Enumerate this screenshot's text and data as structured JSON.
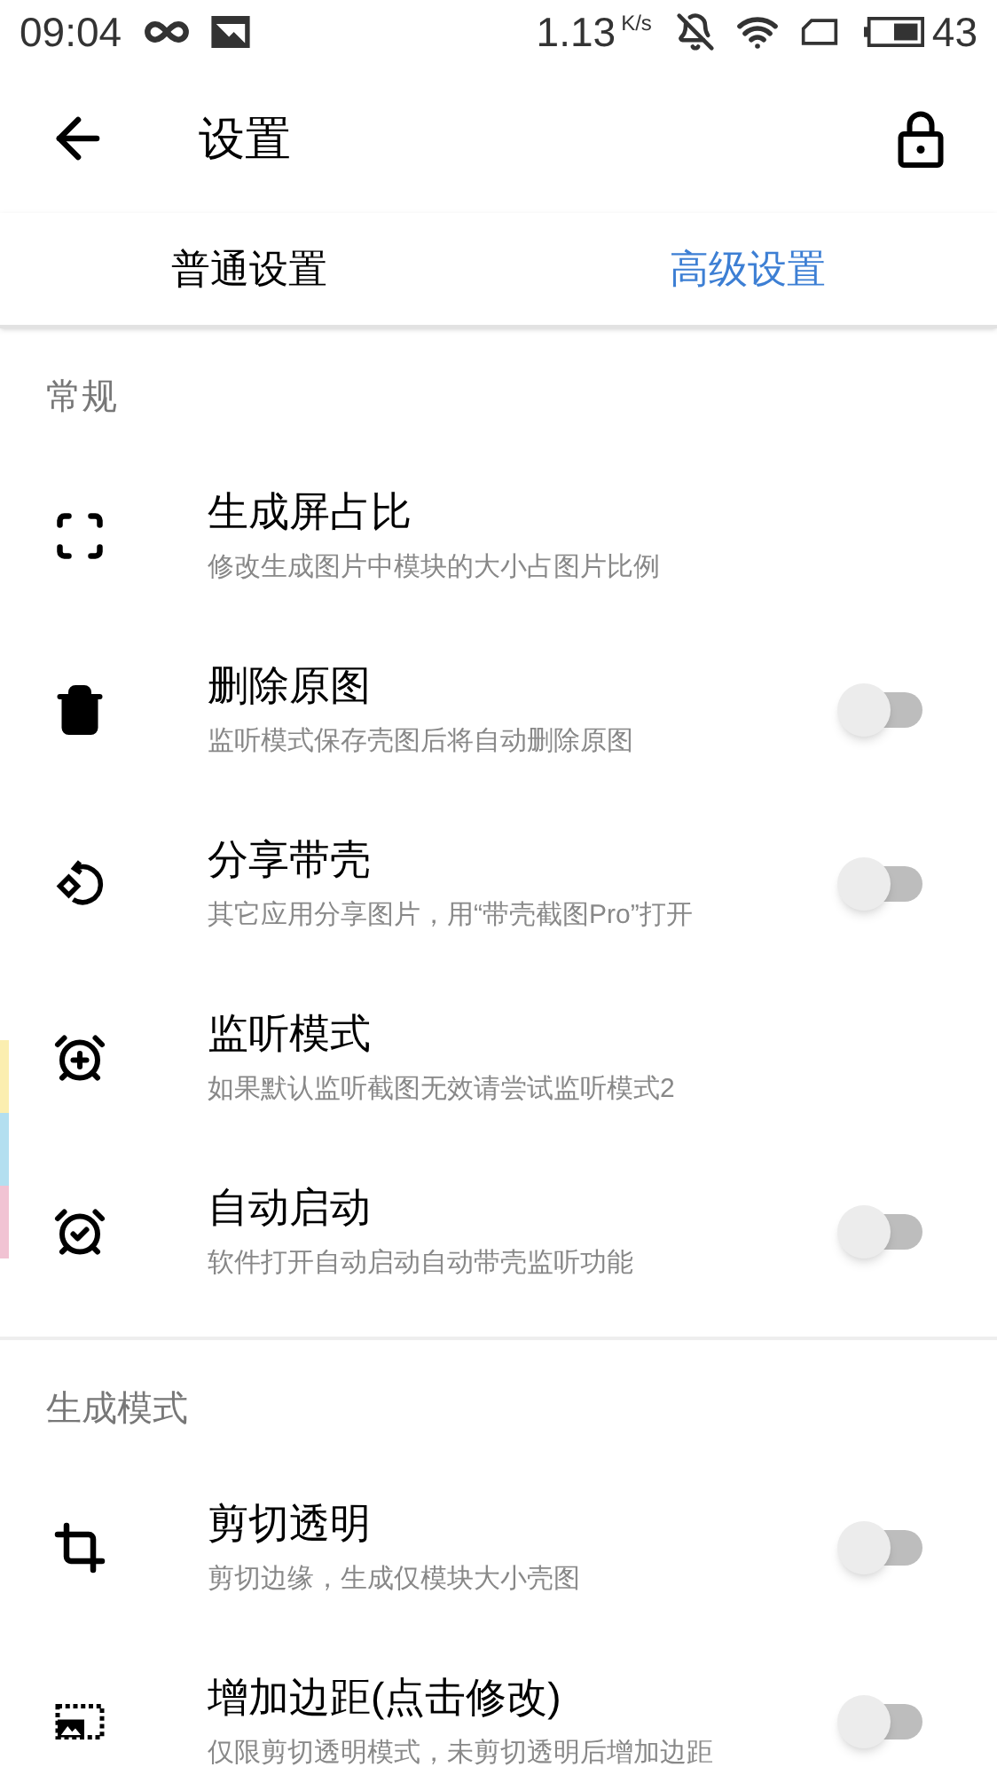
{
  "status_bar": {
    "time": "09:04",
    "speed": "1.13",
    "speed_unit": "K/s",
    "battery": "43"
  },
  "toolbar": {
    "title": "设置"
  },
  "tabs": [
    {
      "label": "普通设置",
      "selected": false
    },
    {
      "label": "高级设置",
      "selected": true
    }
  ],
  "edge_strips": [
    {
      "color": "#fbeeb0"
    },
    {
      "color": "#b3dff0"
    },
    {
      "color": "#f1c3d3"
    }
  ],
  "sections": [
    {
      "header": "常规",
      "items": [
        {
          "kind": "plain",
          "title": "生成屏占比",
          "subtitle": "修改生成图片中模块的大小占图片比例"
        },
        {
          "kind": "toggle",
          "title": "删除原图",
          "subtitle": "监听模式保存壳图后将自动删除原图",
          "on": false
        },
        {
          "kind": "toggle",
          "title": "分享带壳",
          "subtitle": "其它应用分享图片，用“带壳截图Pro”打开",
          "on": false
        },
        {
          "kind": "plain",
          "title": "监听模式",
          "subtitle": "如果默认监听截图无效请尝试监听模式2"
        },
        {
          "kind": "toggle",
          "title": "自动启动",
          "subtitle": "软件打开自动启动自动带壳监听功能",
          "on": false
        }
      ]
    },
    {
      "header": "生成模式",
      "items": [
        {
          "kind": "toggle",
          "title": "剪切透明",
          "subtitle": "剪切边缘，生成仅模块大小壳图",
          "on": false
        },
        {
          "kind": "toggle",
          "title": "增加边距(点击修改)",
          "subtitle": "仅限剪切透明模式，未剪切透明后增加边距",
          "on": false
        }
      ]
    }
  ]
}
